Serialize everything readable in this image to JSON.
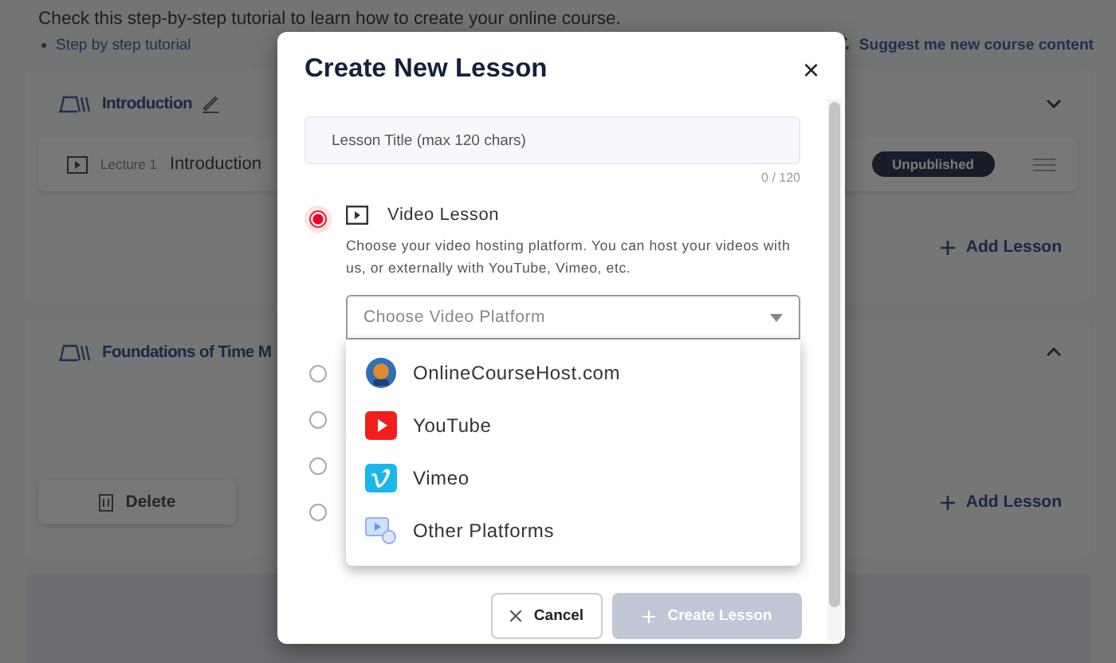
{
  "intro": {
    "text": "Check this step-by-step tutorial to learn how to create your online course.",
    "link": "Step by step tutorial",
    "suggest": "Suggest me new course content"
  },
  "sections": [
    {
      "title": "Introduction",
      "editable": true,
      "expanded": false,
      "lectures": [
        {
          "number": "Lecture 1",
          "title": "Introduction",
          "status": "Unpublished"
        }
      ],
      "add": "Add Lesson"
    },
    {
      "title": "Foundations of Time M",
      "editable": false,
      "expanded": true,
      "delete": "Delete",
      "add": "Add Lesson"
    }
  ],
  "modal": {
    "title": "Create New Lesson",
    "close": "×",
    "title_field": {
      "placeholder": "Lesson Title (max 120 chars)",
      "counter": "0 / 120"
    },
    "lesson_types": [
      {
        "selected": true,
        "label": "Video Lesson",
        "description": "Choose your video hosting platform. You can host your videos with us, or externally with YouTube, Vimeo, etc."
      },
      {
        "selected": false
      },
      {
        "selected": false
      },
      {
        "selected": false
      },
      {
        "selected": false
      }
    ],
    "platform_select": {
      "placeholder": "Choose Video Platform",
      "expanded": true,
      "options": [
        {
          "kind": "host",
          "label": "OnlineCourseHost.com"
        },
        {
          "kind": "youtube",
          "label": "YouTube"
        },
        {
          "kind": "vimeo",
          "label": "Vimeo"
        },
        {
          "kind": "other",
          "label": "Other Platforms"
        }
      ]
    },
    "cancel": "Cancel",
    "create": {
      "label": "Create Lesson",
      "disabled": true
    }
  }
}
